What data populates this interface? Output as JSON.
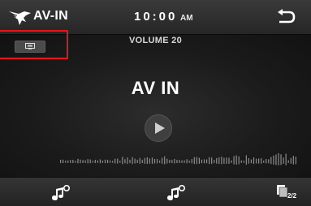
{
  "header": {
    "source_logo_icon": "eagle-logo-icon",
    "source_title": "AV-IN",
    "clock_time": "10:00",
    "clock_ampm": "AM",
    "back_icon": "back-arrow-icon"
  },
  "main": {
    "volume_label": "VOLUME 20",
    "title": "AV IN",
    "play_icon": "play-icon",
    "display_badge_icon": "display-icon",
    "waveform_icon": "audio-waveform"
  },
  "bottombar": {
    "button_1_icon": "music-settings-icon",
    "button_2_icon": "music-settings-icon",
    "page_indicator": "2/2"
  },
  "colors": {
    "highlight": "#e8141b",
    "background": "#111111"
  }
}
